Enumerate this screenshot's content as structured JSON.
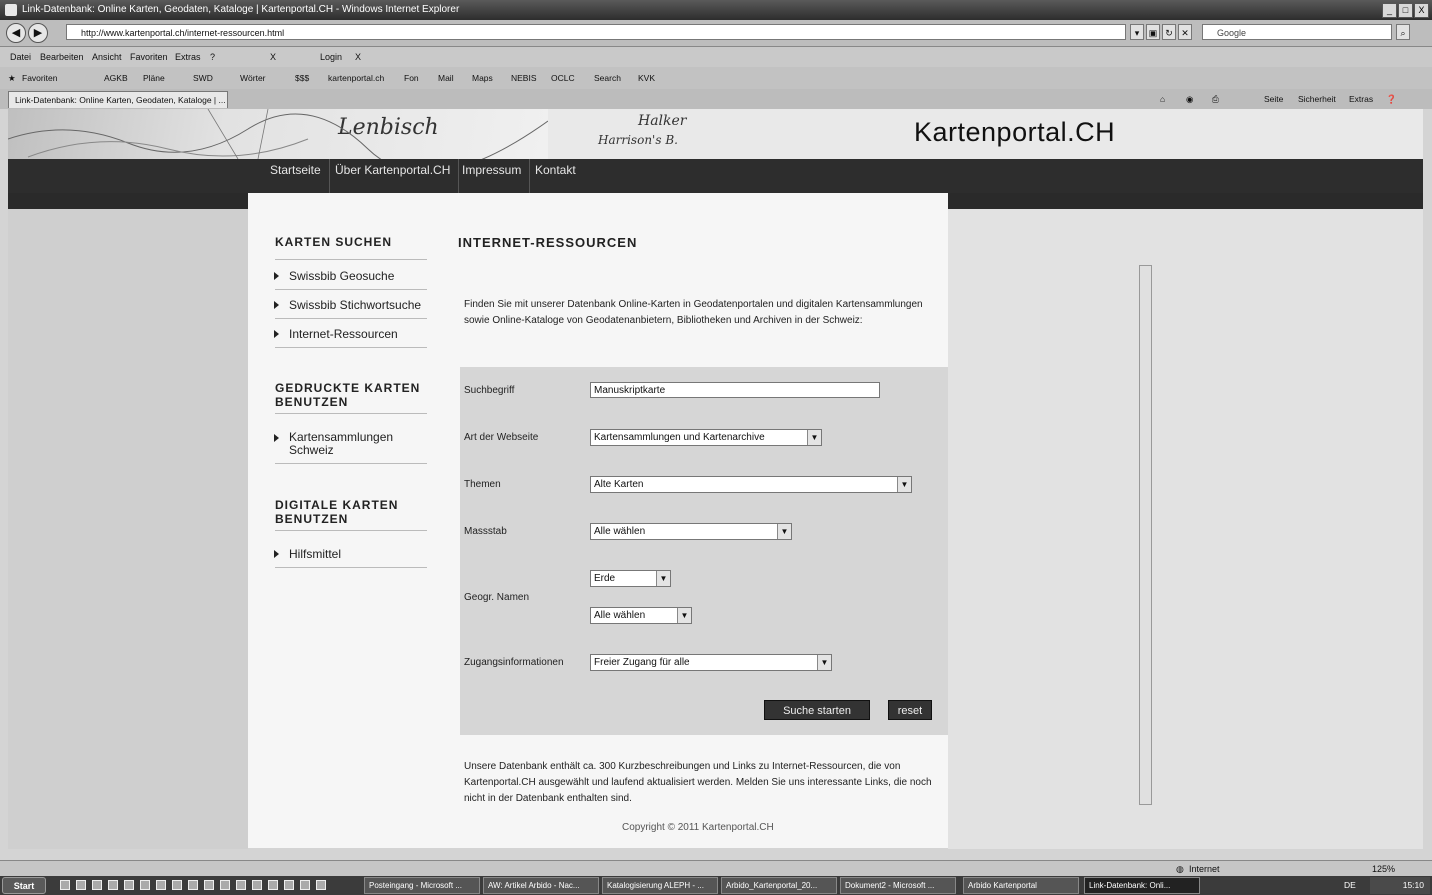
{
  "window": {
    "title": "Link-Datenbank: Online Karten, Geodaten, Kataloge | Kartenportal.CH - Windows Internet Explorer",
    "buttons": [
      "_",
      "□",
      "X"
    ]
  },
  "addressbar": {
    "url": "http://www.kartenportal.ch/internet-ressourcen.html",
    "search_placeholder": "Google"
  },
  "menubar": {
    "items": [
      "Datei",
      "Bearbeiten",
      "Ansicht",
      "Favoriten",
      "Extras",
      "?"
    ],
    "right_items": [
      "X",
      "Login",
      "X"
    ]
  },
  "favorites": {
    "label": "Favoriten",
    "items": [
      "AGKB",
      "Pläne",
      "SWD",
      "Wörter",
      "$$$",
      "kartenportal.ch",
      "Fon",
      "Mail",
      "Maps",
      "NEBIS",
      "OCLC",
      "Search",
      "KVK"
    ]
  },
  "tabbar": {
    "tab_label": "Link-Datenbank: Online Karten, Geodaten, Kataloge | ...",
    "right_items": [
      "Seite",
      "Sicherheit",
      "Extras"
    ]
  },
  "site": {
    "brand": "Kartenportal.CH",
    "nav": [
      "Startseite",
      "Über Kartenportal.CH",
      "Impressum",
      "Kontakt"
    ],
    "map_words": [
      "Lenbisch",
      "Harrison's B.",
      "Halker"
    ]
  },
  "sidebar": {
    "section1_title": "KARTEN SUCHEN",
    "section1_items": [
      "Swissbib Geosuche",
      "Swissbib Stichwortsuche",
      "Internet-Ressourcen"
    ],
    "section2_title_line1": "GEDRUCKTE KARTEN",
    "section2_title_line2": "BENUTZEN",
    "section2_item_line1": "Kartensammlungen",
    "section2_item_line2": "Schweiz",
    "section3_title_line1": "DIGITALE KARTEN",
    "section3_title_line2": "BENUTZEN",
    "section3_items": [
      "Hilfsmittel"
    ]
  },
  "main": {
    "title": "INTERNET-RESSOURCEN",
    "intro": "Finden Sie mit unserer Datenbank Online-Karten in Geodatenportalen und digitalen Kartensammlungen sowie Online-Kataloge von Geodatenanbietern, Bibliotheken und Archiven in der Schweiz:",
    "form": {
      "suchbegriff_label": "Suchbegriff",
      "suchbegriff_value": "Manuskriptkarte",
      "webseite_label": "Art der Webseite",
      "webseite_value": "Kartensammlungen und Kartenarchive",
      "themen_label": "Themen",
      "themen_value": "Alte Karten",
      "massstab_label": "Massstab",
      "massstab_value": "Alle wählen",
      "geo_label": "Geogr. Namen",
      "geo_value1": "Erde",
      "geo_value2": "Alle wählen",
      "zugang_label": "Zugangsinformationen",
      "zugang_value": "Freier Zugang für alle",
      "submit": "Suche starten",
      "reset": "reset"
    },
    "footer_note": "Unsere Datenbank enthält ca. 300 Kurzbeschreibungen und Links zu Internet-Ressourcen, die von Kartenportal.CH ausgewählt und laufend aktualisiert werden. Melden Sie uns interessante Links, die noch nicht in der Datenbank enthalten sind.",
    "copyright": "Copyright © 2011 Kartenportal.CH"
  },
  "statusbar": {
    "zone": "Internet",
    "zoom": "125%"
  },
  "taskbar": {
    "start": "Start",
    "tasks": [
      "Posteingang - Microsoft ...",
      "AW: Artikel Arbido - Nac...",
      "Katalogisierung ALEPH - ...",
      "Arbido_Kartenportal_20...",
      "Dokument2 - Microsoft ...",
      "Arbido Kartenportal",
      "Link-Datenbank: Onli..."
    ],
    "lang": "DE",
    "clock": "15:10"
  },
  "colors": {
    "navbar": "#2d2d2d",
    "content_bg": "#f6f6f6",
    "form_bg": "#d6d6d6",
    "button": "#333333"
  }
}
